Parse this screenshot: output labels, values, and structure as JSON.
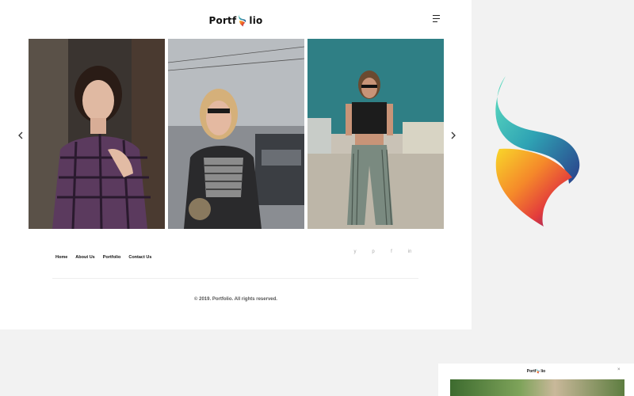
{
  "header": {
    "logo_left": "Portf",
    "logo_right": "lio"
  },
  "icons": {
    "menu": "hamburger-menu-icon",
    "prev": "chevron-left-icon",
    "next": "chevron-right-icon"
  },
  "gallery": {
    "photos": [
      {
        "subject": "woman-plaid-shirt"
      },
      {
        "subject": "woman-sunglasses-car"
      },
      {
        "subject": "woman-striped-pants"
      }
    ]
  },
  "footer": {
    "nav": [
      "Home",
      "About Us",
      "Portfolio",
      "Contact Us"
    ],
    "social": [
      "twitter-icon",
      "pinterest-icon",
      "facebook-icon",
      "linkedin-icon"
    ],
    "social_glyphs": [
      "y",
      "p",
      "f",
      "in"
    ],
    "copyright": "© 2019. Portfolio. All rights reserved."
  },
  "colors": {
    "brand_teal": "#3cc9b4",
    "brand_purple": "#7a1b7a",
    "brand_orange": "#f28c28",
    "background": "#f2f2f2"
  },
  "mini_preview": {
    "logo_left": "Portf",
    "logo_right": "lio",
    "close_glyph": "×"
  }
}
